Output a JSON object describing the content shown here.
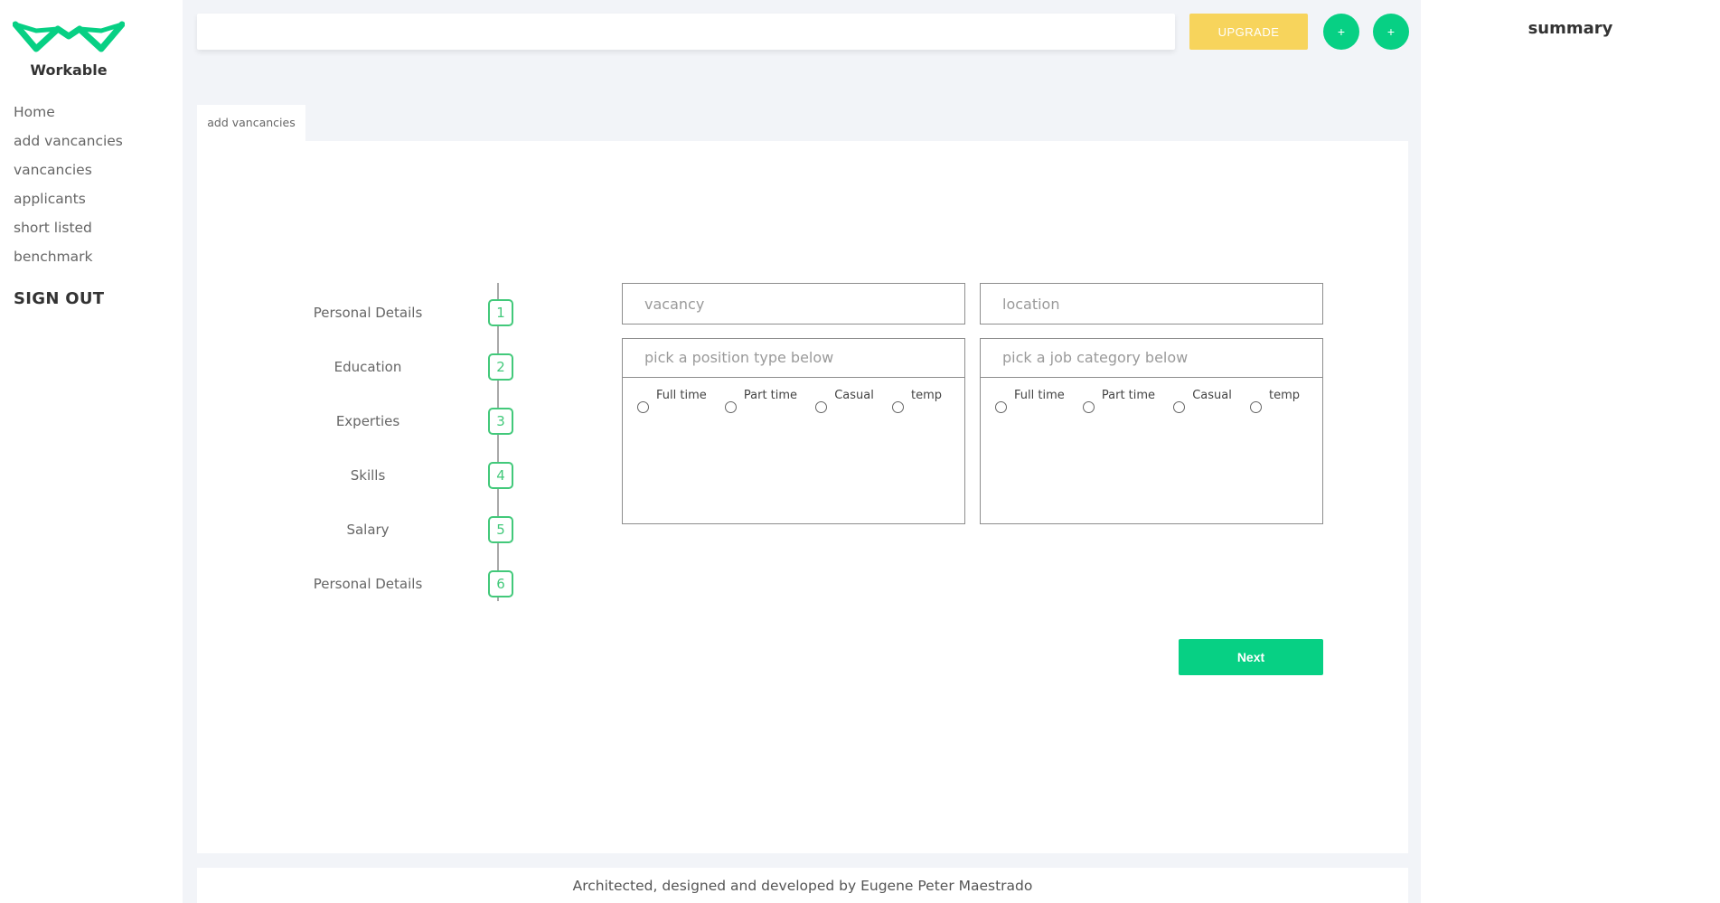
{
  "brand": {
    "name": "Workable",
    "accent": "#07d084"
  },
  "sidebar": {
    "items": [
      {
        "label": "Home"
      },
      {
        "label": "add vancancies"
      },
      {
        "label": "vancancies"
      },
      {
        "label": "applicants"
      },
      {
        "label": "short listed"
      },
      {
        "label": "benchmark"
      }
    ],
    "signout_label": "SIGN OUT"
  },
  "topbar": {
    "search_placeholder": "",
    "upgrade_label": "UPGRADE",
    "circle_button_1": "+",
    "circle_button_2": "+",
    "upgrade_color": "#f7d45c"
  },
  "tab": {
    "label": "add vancancies"
  },
  "stepper": {
    "steps": [
      {
        "label": "Personal Details",
        "num": "1"
      },
      {
        "label": "Education",
        "num": "2"
      },
      {
        "label": "Experties",
        "num": "3"
      },
      {
        "label": "Skills",
        "num": "4"
      },
      {
        "label": "Salary",
        "num": "5"
      },
      {
        "label": "Personal Details",
        "num": "6"
      }
    ]
  },
  "form": {
    "vacancy_placeholder": "vacancy",
    "location_placeholder": "location",
    "position_type": {
      "header": "pick a position type below",
      "options": [
        "Full time",
        "Part time",
        "Casual",
        "temp"
      ]
    },
    "job_category": {
      "header": "pick a job category below",
      "options": [
        "Full time",
        "Part time",
        "Casual",
        "temp"
      ]
    },
    "next_label": "Next"
  },
  "footer": {
    "text": "Architected, designed and developed by Eugene Peter Maestrado"
  },
  "summary": {
    "title": "summary"
  }
}
